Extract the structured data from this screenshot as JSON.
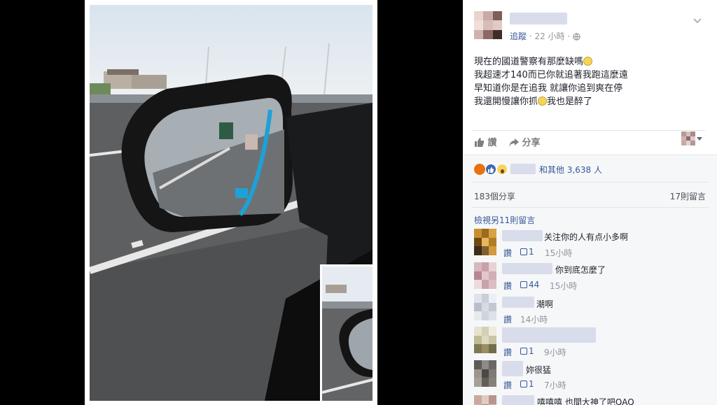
{
  "post": {
    "follow_label": "追蹤",
    "time": "22 小時",
    "text_lines": [
      "現在的國道警察有那麼缺嗎",
      "我超速才140而已你就追著我跑這麼遠",
      "早知道你是在追我 就讓你追到爽在停",
      "我還開慢讓你抓",
      "我也是醉了"
    ],
    "like_label": "讚",
    "share_label": "分享"
  },
  "reactions": {
    "others_text": "和其他 3,638 人",
    "shares": "183個分享",
    "comments_count": "17則留言"
  },
  "comments": {
    "view_more": "檢視另11則留言",
    "like_label": "讚",
    "items": [
      {
        "text": "关注你的人有点小多啊",
        "likes": "1",
        "time": "15小時"
      },
      {
        "text": "你到底怎麼了",
        "likes": "44",
        "time": "15小時"
      },
      {
        "text": "潮啊",
        "likes": "",
        "time": "14小時"
      },
      {
        "text": "",
        "likes": "1",
        "time": "9小時"
      },
      {
        "text": "妳很猛",
        "likes": "1",
        "time": "7小時"
      },
      {
        "text": "嘻嘻嘻 也間大神了吧QAQ",
        "likes": "",
        "time": ""
      }
    ]
  },
  "icons": [
    "chevron-down-icon",
    "globe-icon",
    "like-icon",
    "share-icon",
    "angry-reaction-icon",
    "like-reaction-icon",
    "wow-reaction-icon",
    "grin-emoji-icon"
  ],
  "colors": {
    "link": "#365899",
    "meta": "#90949c",
    "text": "#1d2129",
    "reaction_like": "#4267b2",
    "reaction_angry": "#e9710f"
  }
}
